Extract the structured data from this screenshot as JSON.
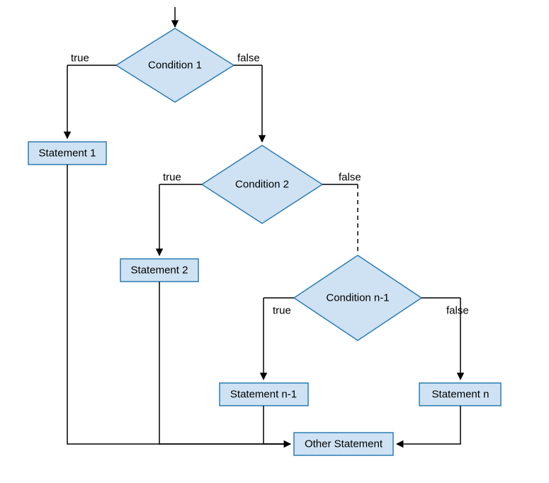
{
  "conditions": {
    "c1": "Condition 1",
    "c2": "Condition 2",
    "cn1": "Condition n-1"
  },
  "statements": {
    "s1": "Statement 1",
    "s2": "Statement 2",
    "sn1": "Statement n-1",
    "sn": "Statement n",
    "other": "Other Statement"
  },
  "edges": {
    "true": "true",
    "false": "false"
  }
}
